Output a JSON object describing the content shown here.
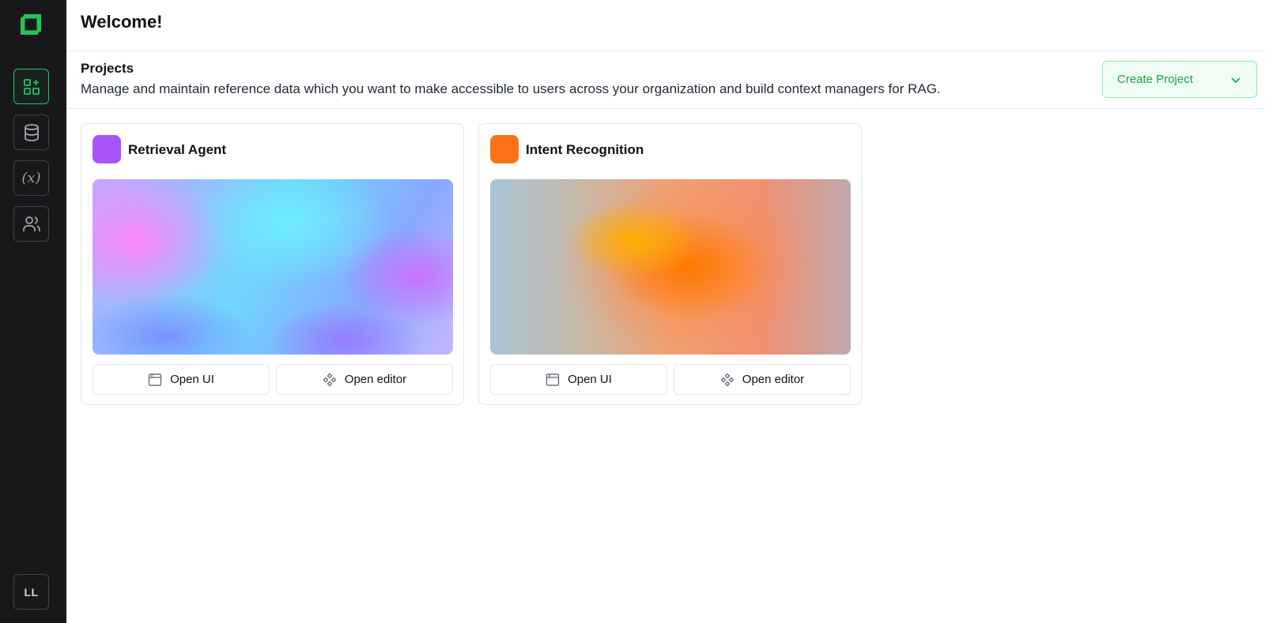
{
  "header": {
    "title": "Welcome!"
  },
  "section": {
    "title": "Projects",
    "description": "Manage and maintain reference data which you want to make accessible to users across your organization and build context managers for RAG.",
    "create_label": "Create Project"
  },
  "sidebar": {
    "items": [
      {
        "icon": "dashboard-add-icon",
        "active": true
      },
      {
        "icon": "database-icon",
        "active": false
      },
      {
        "icon": "variable-icon",
        "label": "(x)",
        "active": false
      },
      {
        "icon": "users-icon",
        "active": false
      }
    ],
    "avatar_initials": "LL"
  },
  "projects": [
    {
      "name": "Retrieval Agent",
      "color": "#a855f7",
      "open_ui_label": "Open UI",
      "open_editor_label": "Open editor"
    },
    {
      "name": "Intent Recognition",
      "color": "#f97316",
      "open_ui_label": "Open UI",
      "open_editor_label": "Open editor"
    }
  ],
  "colors": {
    "accent": "#22c55e",
    "sidebar_bg": "#18181b"
  }
}
